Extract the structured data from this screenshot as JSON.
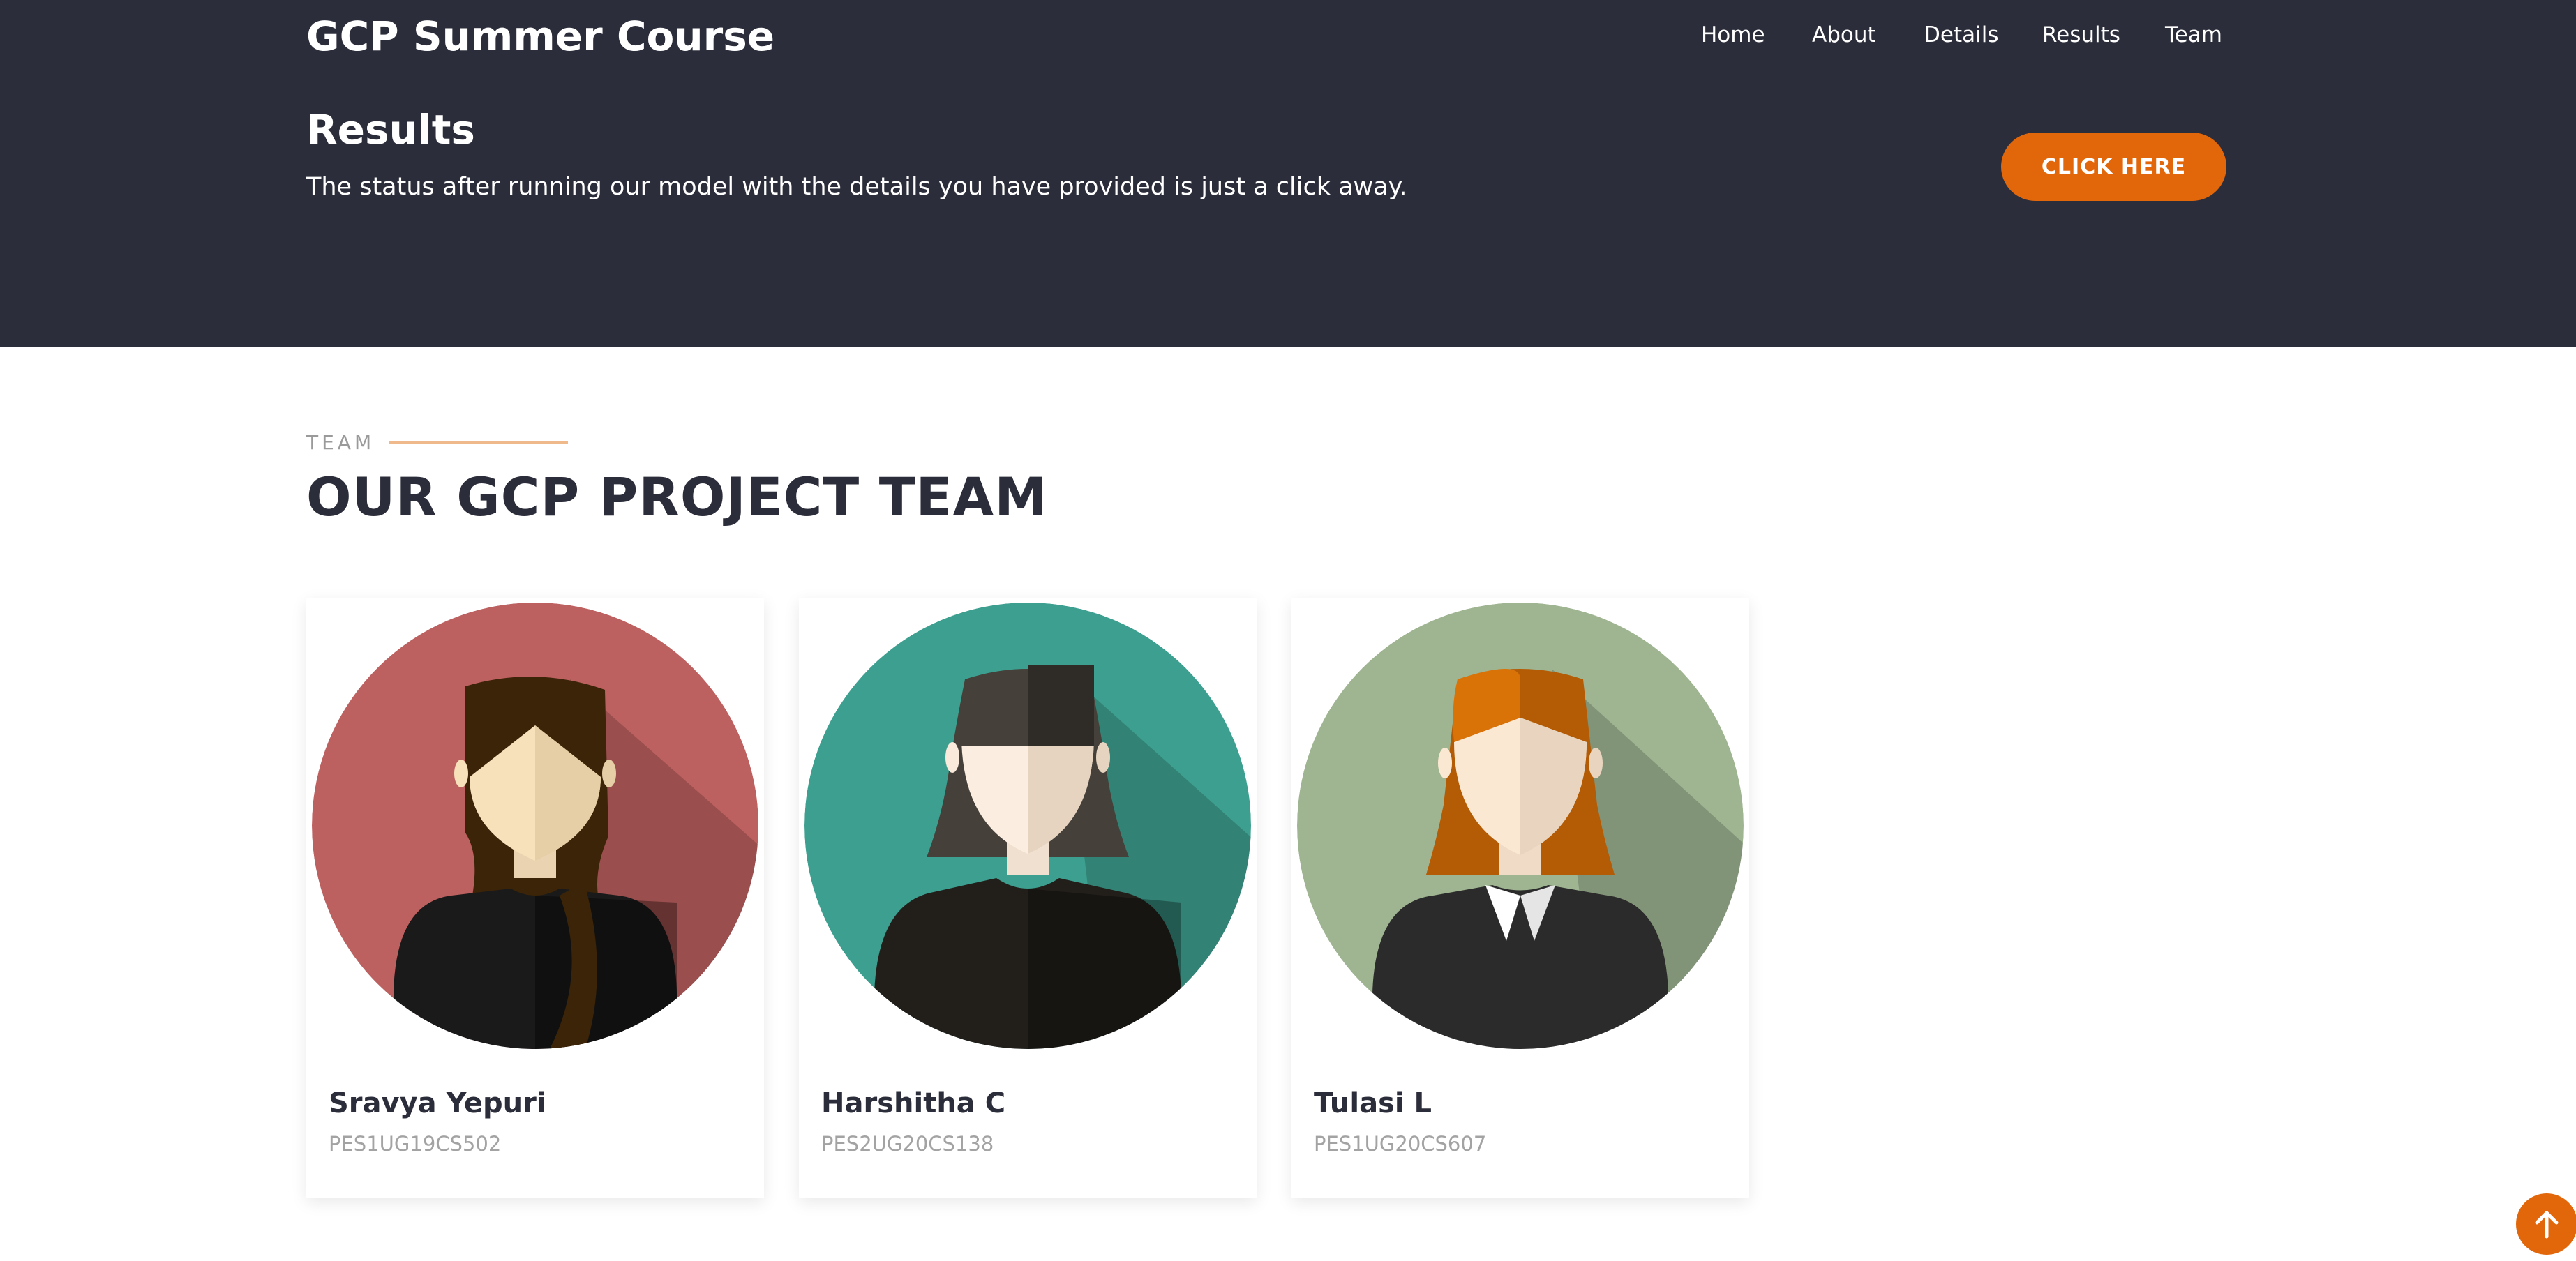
{
  "header": {
    "brand": "GCP Summer Course",
    "nav": [
      "Home",
      "About",
      "Details",
      "Results",
      "Team"
    ]
  },
  "hero": {
    "title": "Results",
    "description": "The status after running our model with the details you have provided is just a click away.",
    "cta_label": "CLICK HERE"
  },
  "team": {
    "eyebrow": "TEAM",
    "heading": "OUR GCP PROJECT TEAM",
    "members": [
      {
        "name": "Sravya Yepuri",
        "id": "PES1UG19CS502",
        "avatar": "female-avatar-long-brown-hair-icon",
        "bg_color": "#bd6060"
      },
      {
        "name": "Harshitha C",
        "id": "PES2UG20CS138",
        "avatar": "female-avatar-bob-hair-icon",
        "bg_color": "#3d9f8f"
      },
      {
        "name": "Tulasi L",
        "id": "PES1UG20CS607",
        "avatar": "female-avatar-red-hair-collar-icon",
        "bg_color": "#9fb592"
      }
    ]
  },
  "back_to_top": {
    "icon": "arrow-up-icon"
  },
  "colors": {
    "header_bg": "#2b2d3a",
    "accent": "#e2670b",
    "heading_text": "#2b2d3a",
    "muted_text": "#a3a3a3"
  }
}
